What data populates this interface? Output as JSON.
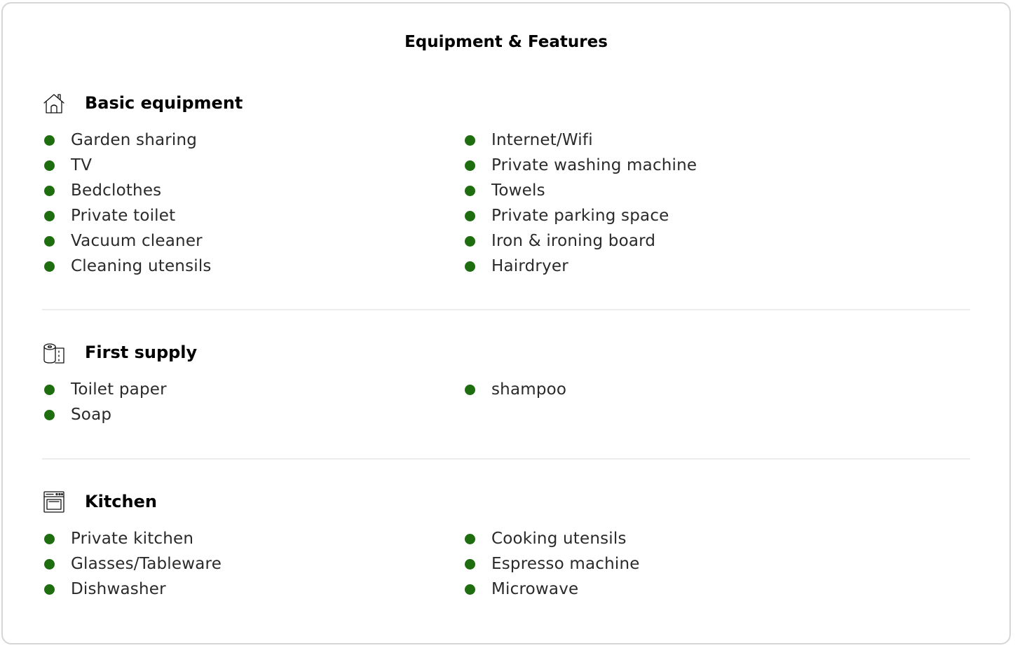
{
  "title": "Equipment & Features",
  "colors": {
    "bullet": "#1e6e10",
    "border": "#d6d6d6",
    "divider": "#ececec"
  },
  "sections": [
    {
      "icon": "house-icon",
      "title": "Basic equipment",
      "left_items": [
        "Garden sharing",
        "TV",
        "Bedclothes",
        "Private toilet",
        "Vacuum cleaner",
        "Cleaning utensils"
      ],
      "right_items": [
        "Internet/Wifi",
        "Private washing machine",
        "Towels",
        "Private parking space",
        "Iron & ironing board",
        "Hairdryer"
      ]
    },
    {
      "icon": "toilet-paper-icon",
      "title": "First supply",
      "left_items": [
        "Toilet paper",
        "Soap"
      ],
      "right_items": [
        "shampoo"
      ]
    },
    {
      "icon": "oven-icon",
      "title": "Kitchen",
      "left_items": [
        "Private kitchen",
        "Glasses/Tableware",
        "Dishwasher"
      ],
      "right_items": [
        "Cooking utensils",
        "Espresso machine",
        "Microwave"
      ]
    }
  ]
}
